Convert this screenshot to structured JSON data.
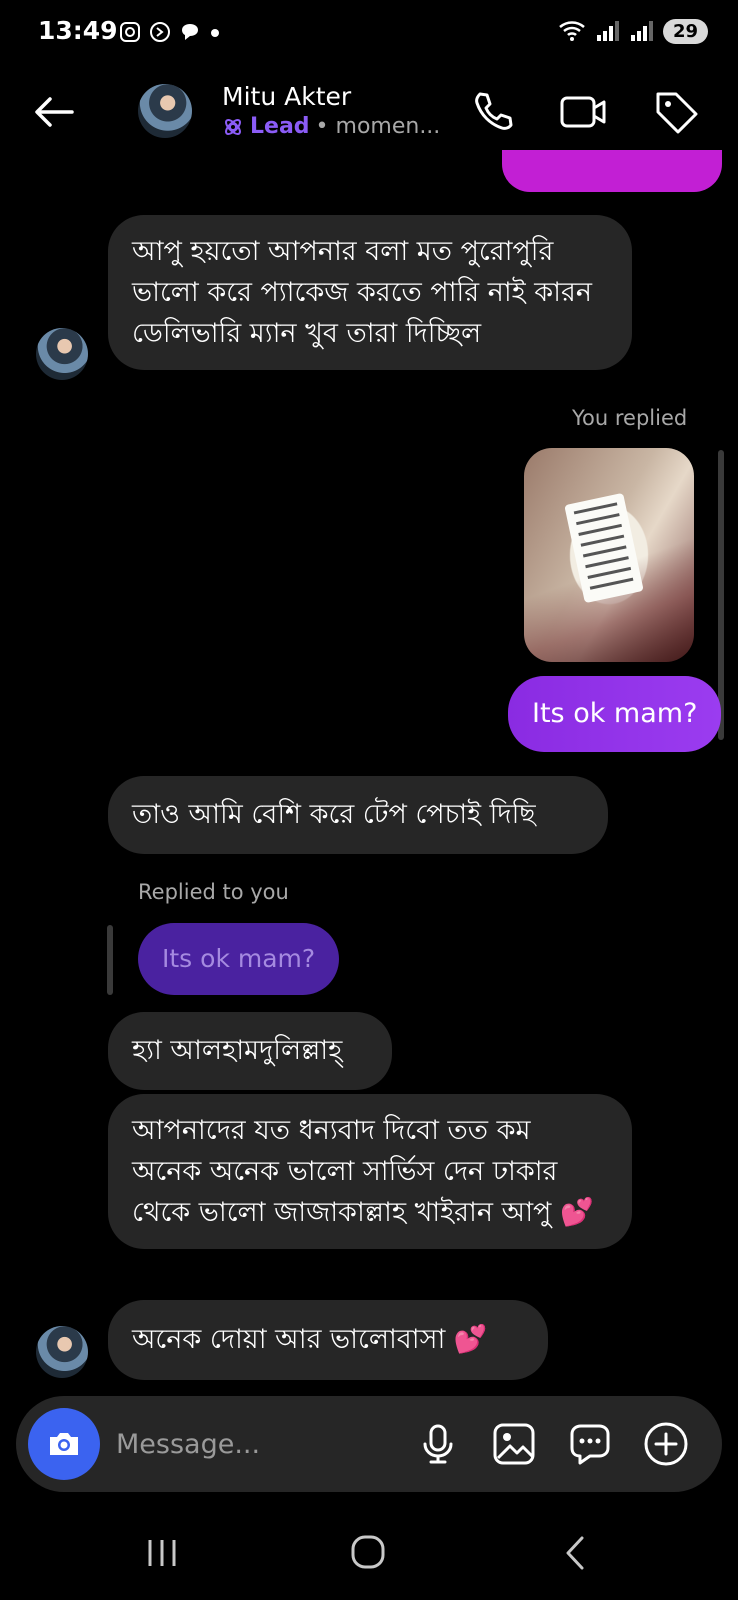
{
  "status_bar": {
    "time": "13:49",
    "battery": "29"
  },
  "header": {
    "contact_name": "Mitu Akter",
    "lead_label": "Lead",
    "activity": "• momen..."
  },
  "messages": {
    "m1": "আপু হয়তো আপনার বলা মত পুরোপুরি ভালো করে প্যাকেজ করতে পারি নাই কারন ডেলিভারি ম্যান খুব তারা দিচ্ছিল",
    "you_replied": "You replied",
    "m2": "Its ok mam?",
    "m3": "তাও আমি বেশি করে টেপ পেচাই দিছি",
    "replied_to_you": "Replied to you",
    "quoted": "Its ok mam?",
    "m4": "হ্যা আলহামদুলিল্লাহ্",
    "m5": "আপনাদের যত ধন্যবাদ দিবো তত কম অনেক অনেক ভালো সার্ভিস দেন ঢাকার থেকে ভালো জাজাকাল্লাহ খাইরান আপু 💕",
    "m6": "অনেক দোয়া আর ভালোবাসা 💕"
  },
  "composer": {
    "placeholder": "Message..."
  },
  "colors": {
    "outgoing": "#8a2be2",
    "incoming": "#262626",
    "accent": "#3b63f0",
    "lead": "#8b5cf6"
  },
  "icons": [
    "back-arrow-icon",
    "phone-icon",
    "video-icon",
    "tag-icon",
    "camera-icon",
    "mic-icon",
    "gallery-icon",
    "sticker-icon",
    "plus-icon"
  ]
}
